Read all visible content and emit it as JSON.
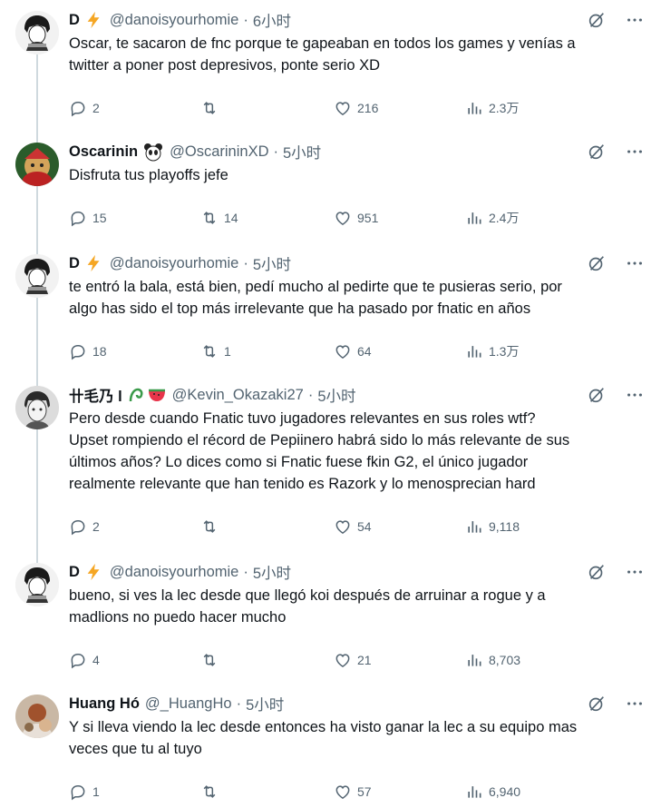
{
  "tweets": [
    {
      "name": "D",
      "handle": "@danoisyourhomie",
      "time": "6小时",
      "text": [
        "Oscar, te sacaron de fnc porque te gapeaban en todos los games y venías a",
        "twitter a poner post depresivos, ponte serio XD"
      ],
      "replies": "2",
      "retweets": "",
      "likes": "216",
      "views": "2.3万"
    },
    {
      "name": "Oscarinin",
      "handle": "@OscarininXD",
      "time": "5小时",
      "text": [
        "Disfruta tus playoffs jefe"
      ],
      "replies": "15",
      "retweets": "14",
      "likes": "951",
      "views": "2.4万"
    },
    {
      "name": "D",
      "handle": "@danoisyourhomie",
      "time": "5小时",
      "text": [
        "te entró la bala, está bien, pedí mucho al pedirte que te pusieras serio, por",
        "algo has sido el top más irrelevante que ha pasado por fnatic en años"
      ],
      "replies": "18",
      "retweets": "1",
      "likes": "64",
      "views": "1.3万"
    },
    {
      "name": "卄毛乃 l",
      "handle": "@Kevin_Okazaki27",
      "time": "5小时",
      "text": [
        "Pero desde cuando Fnatic tuvo jugadores relevantes en sus roles wtf?",
        "Upset rompiendo el récord de Pepiinero habrá sido lo más relevante de sus",
        "últimos años? Lo dices como si Fnatic fuese fkin G2, el único jugador",
        "realmente relevante que han tenido es Razork y lo menosprecian hard"
      ],
      "replies": "2",
      "retweets": "",
      "likes": "54",
      "views": "9,118"
    },
    {
      "name": "D",
      "handle": "@danoisyourhomie",
      "time": "5小时",
      "text": [
        "bueno, si ves la lec desde que llegó koi después de arruinar a rogue y a",
        "madlions no puedo hacer mucho"
      ],
      "replies": "4",
      "retweets": "",
      "likes": "21",
      "views": "8,703"
    },
    {
      "name": "Huang Hó",
      "handle": "@_HuangHo",
      "time": "5小时",
      "text": [
        "Y si lleva viendo la lec desde entonces ha visto ganar la lec a su equipo mas",
        "veces que tu al tuyo"
      ],
      "replies": "1",
      "retweets": "",
      "likes": "57",
      "views": "6,940"
    }
  ],
  "separator": "·",
  "colors": {
    "text": "#0f1419",
    "muted": "#536471",
    "line": "#cfd9de",
    "bolt": "#f5a623"
  }
}
